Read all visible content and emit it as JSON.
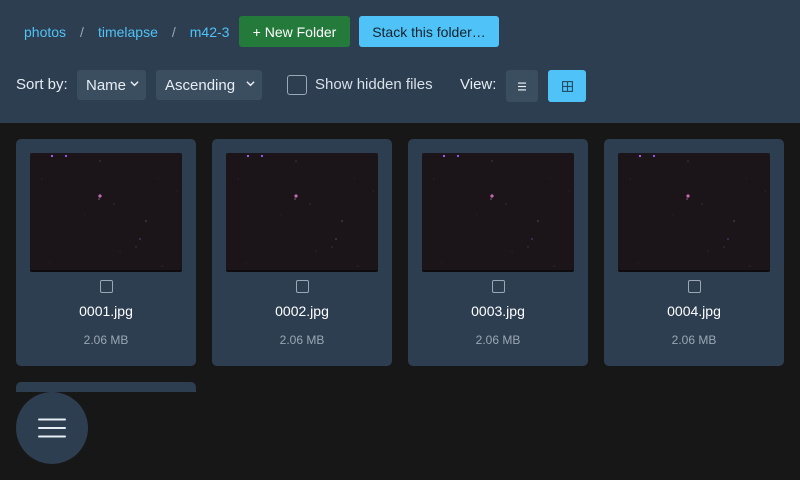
{
  "breadcrumb": {
    "items": [
      "photos",
      "timelapse",
      "m42-3"
    ],
    "separator": "/"
  },
  "toolbar": {
    "new_folder_label": "+ New Folder",
    "stack_label": "Stack this folder…",
    "sort_label": "Sort by:",
    "sort_field": "Name",
    "sort_order": "Ascending",
    "show_hidden_label": "Show hidden files",
    "show_hidden_checked": false,
    "view_label": "View:",
    "view_list_icon": "list-icon",
    "view_grid_icon": "grid-icon",
    "active_view": "grid"
  },
  "files": [
    {
      "name": "0001.jpg",
      "size": "2.06 MB",
      "checked": false
    },
    {
      "name": "0002.jpg",
      "size": "2.06 MB",
      "checked": false
    },
    {
      "name": "0003.jpg",
      "size": "2.06 MB",
      "checked": false
    },
    {
      "name": "0004.jpg",
      "size": "2.06 MB",
      "checked": false
    }
  ],
  "fab": {
    "icon": "hamburger-menu-icon"
  },
  "colors": {
    "header_bg": "#2c3e50",
    "page_bg": "#171717",
    "accent": "#4fc3f7",
    "success": "#237a3a"
  }
}
